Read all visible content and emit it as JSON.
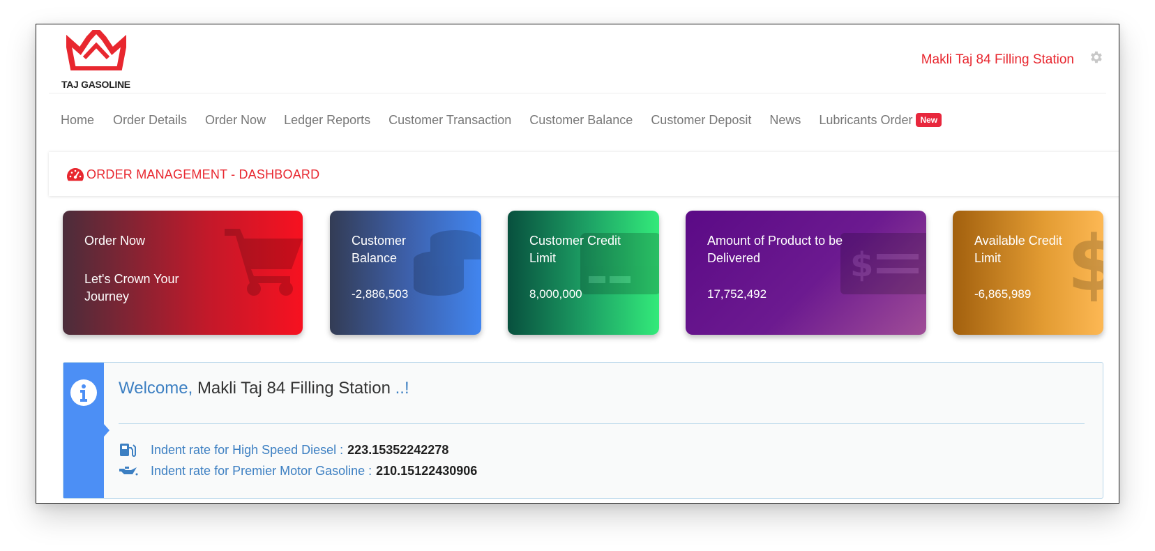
{
  "brand": {
    "logo_text": "TAJ GASOLINE",
    "accent": "#e8272f"
  },
  "header": {
    "station_name": "Makli Taj 84 Filling Station",
    "settings_icon": "gear-icon"
  },
  "nav": {
    "items": [
      {
        "label": "Home"
      },
      {
        "label": "Order Details"
      },
      {
        "label": "Order Now"
      },
      {
        "label": "Ledger Reports"
      },
      {
        "label": "Customer Transaction"
      },
      {
        "label": "Customer Balance"
      },
      {
        "label": "Customer Deposit"
      },
      {
        "label": "News"
      },
      {
        "label": "Lubricants Order",
        "badge": "New"
      }
    ]
  },
  "page": {
    "title": "ORDER MANAGEMENT - DASHBOARD",
    "title_icon": "speedometer-icon"
  },
  "cards": [
    {
      "label": "Order Now",
      "value": "Let's Crown Your Journey",
      "icon": "cart-icon"
    },
    {
      "label": "Customer Balance",
      "value": "-2,886,503",
      "icon": "coins-icon"
    },
    {
      "label": "Customer Credit Limit",
      "value": "8,000,000",
      "icon": "credit-card-icon"
    },
    {
      "label": "Amount of Product to be Delivered",
      "value": "17,752,492",
      "icon": "money-check-icon"
    },
    {
      "label": "Available Credit Limit",
      "value": "-6,865,989",
      "icon": "dollar-icon"
    }
  ],
  "welcome": {
    "greeting": "Welcome,",
    "station": "Makli Taj 84 Filling Station",
    "suffix": "..!",
    "rates": [
      {
        "label": "Indent rate for High Speed Diesel :",
        "value": "223.15352242278",
        "icon": "gas-pump-icon"
      },
      {
        "label": "Indent rate for Premier Motor Gasoline :",
        "value": "210.15122430906",
        "icon": "oil-can-icon"
      }
    ]
  }
}
